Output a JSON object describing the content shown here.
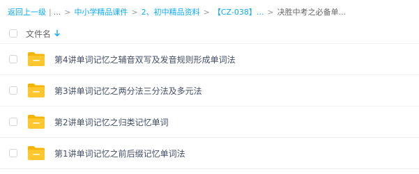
{
  "breadcrumb": {
    "back_label": "返回上一级",
    "divider": "|",
    "ellipsis": "...",
    "separator": ">",
    "items": [
      {
        "label": "中小学精品课件"
      },
      {
        "label": "2、初中精品资料"
      },
      {
        "label": "【CZ-038】..."
      }
    ],
    "current": "决胜中考之必备单..."
  },
  "list_header": {
    "column_label": "文件名",
    "sort_icon": "arrow-down-icon"
  },
  "files": [
    {
      "name": "第4讲单词记忆之辅音双写及发音规则形成单词法",
      "icon": "folder-icon"
    },
    {
      "name": "第3讲单词记忆之两分法三分法及多元法",
      "icon": "folder-icon"
    },
    {
      "name": "第2讲单词记忆之归类记忆单词",
      "icon": "folder-icon"
    },
    {
      "name": "第1讲单词记忆之前后缀记忆单词法",
      "icon": "folder-icon"
    }
  ],
  "colors": {
    "accent": "#09AAFF",
    "folder": "#FFC62E",
    "folder_tab": "#F5B400"
  }
}
